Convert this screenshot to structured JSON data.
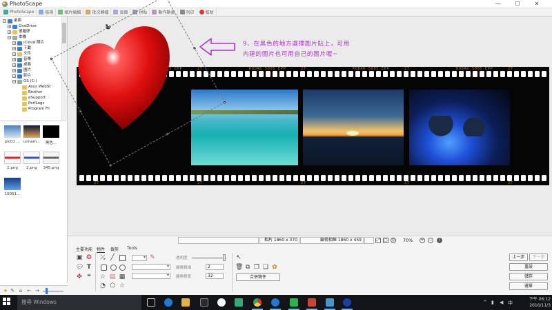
{
  "window": {
    "title": "PhotoScape",
    "minimize": "—",
    "maximize": "☐",
    "close": "✕"
  },
  "tabs": [
    "PhotoScape",
    "檢視",
    "相片編輯",
    "批次轉檔",
    "頁面",
    "拼貼",
    "動作動畫",
    "列印",
    "幫助"
  ],
  "tree": [
    {
      "label": "桌面",
      "indent": 0,
      "icon": "blue",
      "exp": "−"
    },
    {
      "label": "OneDrive",
      "indent": 1,
      "icon": "blue",
      "exp": "+"
    },
    {
      "label": "很羅妤",
      "indent": 1,
      "icon": "folder",
      "exp": "+"
    },
    {
      "label": "本機",
      "indent": 1,
      "icon": "drive",
      "exp": "−"
    },
    {
      "label": "iCloud 照片",
      "indent": 2,
      "icon": "blue",
      "exp": "+"
    },
    {
      "label": "下載",
      "indent": 2,
      "icon": "blue",
      "exp": "+"
    },
    {
      "label": "文件",
      "indent": 2,
      "icon": "folder",
      "exp": "+"
    },
    {
      "label": "音樂",
      "indent": 2,
      "icon": "blue",
      "exp": "+"
    },
    {
      "label": "桌面",
      "indent": 2,
      "icon": "blue",
      "exp": "+"
    },
    {
      "label": "圖片",
      "indent": 2,
      "icon": "blue",
      "exp": "+"
    },
    {
      "label": "影片",
      "indent": 2,
      "icon": "blue",
      "exp": "+"
    },
    {
      "label": "OS (C:)",
      "indent": 2,
      "icon": "drive",
      "exp": "−"
    },
    {
      "label": "Asus WebSt",
      "indent": 3,
      "icon": "folder",
      "exp": ""
    },
    {
      "label": "Brother",
      "indent": 3,
      "icon": "folder",
      "exp": ""
    },
    {
      "label": "eSupport",
      "indent": 3,
      "icon": "folder",
      "exp": ""
    },
    {
      "label": "PerfLogs",
      "indent": 3,
      "icon": "folder",
      "exp": ""
    },
    {
      "label": "Program Fil",
      "indent": 3,
      "icon": "folder",
      "exp": ""
    }
  ],
  "thumbs": [
    {
      "label": "pic01 ...",
      "colors": [
        "#4a7fb8",
        "#cfe3f5"
      ]
    },
    {
      "label": "unnam...",
      "colors": [
        "#0d1a33",
        "#e8a257"
      ]
    },
    {
      "label": "黑色...",
      "colors": [
        "#000000",
        "#000000"
      ]
    },
    {
      "label": "1.png",
      "colors": [
        "#f8f8f8",
        "#dd2222"
      ]
    },
    {
      "label": "2.png",
      "colors": [
        "#f8f8f8",
        "#3355cc"
      ]
    },
    {
      "label": "345.png",
      "colors": [
        "#f4f4f4",
        "#666666"
      ]
    },
    {
      "label": "15051...",
      "colors": [
        "#1b3d80",
        "#5aa0f0"
      ]
    }
  ],
  "film": {
    "text_top": "KODAK 5005 EPP",
    "frame_num": "27",
    "frame_num_bottom": "27"
  },
  "annotation": {
    "line1": "9、在黑色的地方選擇圖片貼上，可用",
    "line2": "內建的圖片也可用自己的圖片喔~"
  },
  "status": {
    "photo_size": "相片 1860 x 370",
    "original_size": "編修相框 1860 x 459",
    "zoom": "70%"
  },
  "bottom": {
    "tabs": [
      "主要功能",
      "物件",
      "裁剪",
      "Tools"
    ],
    "active_tab": "物件",
    "opacity_label": "透明度",
    "line_width_label": "線條粗細",
    "line_width": "2",
    "corner_label": "圓角程度",
    "corner": "32",
    "merge_button": "合併物件",
    "buttons": {
      "undo": "上一步",
      "redo": "下一步",
      "reset": "重設",
      "save": "儲存",
      "menu": "選單"
    }
  },
  "taskbar": {
    "search": "搜尋 Windows",
    "time": "下午 06:12",
    "date": "2016/11/3"
  },
  "colors": {
    "annotation": "#b12fd6",
    "film": "#050505",
    "heart": "#e01010"
  }
}
